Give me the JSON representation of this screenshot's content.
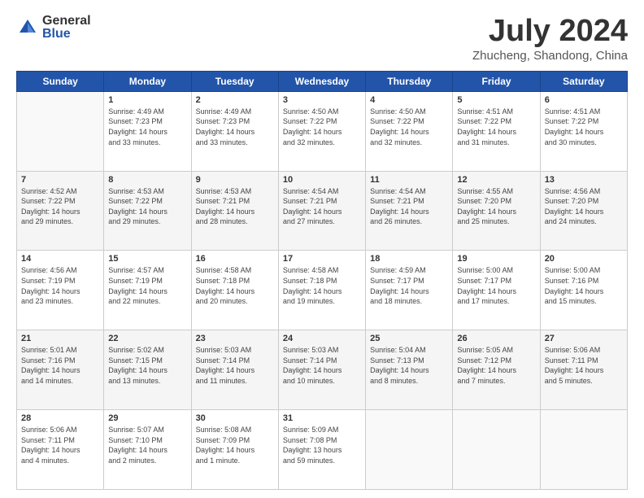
{
  "logo": {
    "general": "General",
    "blue": "Blue"
  },
  "title": "July 2024",
  "subtitle": "Zhucheng, Shandong, China",
  "days_of_week": [
    "Sunday",
    "Monday",
    "Tuesday",
    "Wednesday",
    "Thursday",
    "Friday",
    "Saturday"
  ],
  "weeks": [
    [
      {
        "day": "",
        "info": ""
      },
      {
        "day": "1",
        "info": "Sunrise: 4:49 AM\nSunset: 7:23 PM\nDaylight: 14 hours\nand 33 minutes."
      },
      {
        "day": "2",
        "info": "Sunrise: 4:49 AM\nSunset: 7:23 PM\nDaylight: 14 hours\nand 33 minutes."
      },
      {
        "day": "3",
        "info": "Sunrise: 4:50 AM\nSunset: 7:22 PM\nDaylight: 14 hours\nand 32 minutes."
      },
      {
        "day": "4",
        "info": "Sunrise: 4:50 AM\nSunset: 7:22 PM\nDaylight: 14 hours\nand 32 minutes."
      },
      {
        "day": "5",
        "info": "Sunrise: 4:51 AM\nSunset: 7:22 PM\nDaylight: 14 hours\nand 31 minutes."
      },
      {
        "day": "6",
        "info": "Sunrise: 4:51 AM\nSunset: 7:22 PM\nDaylight: 14 hours\nand 30 minutes."
      }
    ],
    [
      {
        "day": "7",
        "info": "Sunrise: 4:52 AM\nSunset: 7:22 PM\nDaylight: 14 hours\nand 29 minutes."
      },
      {
        "day": "8",
        "info": "Sunrise: 4:53 AM\nSunset: 7:22 PM\nDaylight: 14 hours\nand 29 minutes."
      },
      {
        "day": "9",
        "info": "Sunrise: 4:53 AM\nSunset: 7:21 PM\nDaylight: 14 hours\nand 28 minutes."
      },
      {
        "day": "10",
        "info": "Sunrise: 4:54 AM\nSunset: 7:21 PM\nDaylight: 14 hours\nand 27 minutes."
      },
      {
        "day": "11",
        "info": "Sunrise: 4:54 AM\nSunset: 7:21 PM\nDaylight: 14 hours\nand 26 minutes."
      },
      {
        "day": "12",
        "info": "Sunrise: 4:55 AM\nSunset: 7:20 PM\nDaylight: 14 hours\nand 25 minutes."
      },
      {
        "day": "13",
        "info": "Sunrise: 4:56 AM\nSunset: 7:20 PM\nDaylight: 14 hours\nand 24 minutes."
      }
    ],
    [
      {
        "day": "14",
        "info": "Sunrise: 4:56 AM\nSunset: 7:19 PM\nDaylight: 14 hours\nand 23 minutes."
      },
      {
        "day": "15",
        "info": "Sunrise: 4:57 AM\nSunset: 7:19 PM\nDaylight: 14 hours\nand 22 minutes."
      },
      {
        "day": "16",
        "info": "Sunrise: 4:58 AM\nSunset: 7:18 PM\nDaylight: 14 hours\nand 20 minutes."
      },
      {
        "day": "17",
        "info": "Sunrise: 4:58 AM\nSunset: 7:18 PM\nDaylight: 14 hours\nand 19 minutes."
      },
      {
        "day": "18",
        "info": "Sunrise: 4:59 AM\nSunset: 7:17 PM\nDaylight: 14 hours\nand 18 minutes."
      },
      {
        "day": "19",
        "info": "Sunrise: 5:00 AM\nSunset: 7:17 PM\nDaylight: 14 hours\nand 17 minutes."
      },
      {
        "day": "20",
        "info": "Sunrise: 5:00 AM\nSunset: 7:16 PM\nDaylight: 14 hours\nand 15 minutes."
      }
    ],
    [
      {
        "day": "21",
        "info": "Sunrise: 5:01 AM\nSunset: 7:16 PM\nDaylight: 14 hours\nand 14 minutes."
      },
      {
        "day": "22",
        "info": "Sunrise: 5:02 AM\nSunset: 7:15 PM\nDaylight: 14 hours\nand 13 minutes."
      },
      {
        "day": "23",
        "info": "Sunrise: 5:03 AM\nSunset: 7:14 PM\nDaylight: 14 hours\nand 11 minutes."
      },
      {
        "day": "24",
        "info": "Sunrise: 5:03 AM\nSunset: 7:14 PM\nDaylight: 14 hours\nand 10 minutes."
      },
      {
        "day": "25",
        "info": "Sunrise: 5:04 AM\nSunset: 7:13 PM\nDaylight: 14 hours\nand 8 minutes."
      },
      {
        "day": "26",
        "info": "Sunrise: 5:05 AM\nSunset: 7:12 PM\nDaylight: 14 hours\nand 7 minutes."
      },
      {
        "day": "27",
        "info": "Sunrise: 5:06 AM\nSunset: 7:11 PM\nDaylight: 14 hours\nand 5 minutes."
      }
    ],
    [
      {
        "day": "28",
        "info": "Sunrise: 5:06 AM\nSunset: 7:11 PM\nDaylight: 14 hours\nand 4 minutes."
      },
      {
        "day": "29",
        "info": "Sunrise: 5:07 AM\nSunset: 7:10 PM\nDaylight: 14 hours\nand 2 minutes."
      },
      {
        "day": "30",
        "info": "Sunrise: 5:08 AM\nSunset: 7:09 PM\nDaylight: 14 hours\nand 1 minute."
      },
      {
        "day": "31",
        "info": "Sunrise: 5:09 AM\nSunset: 7:08 PM\nDaylight: 13 hours\nand 59 minutes."
      },
      {
        "day": "",
        "info": ""
      },
      {
        "day": "",
        "info": ""
      },
      {
        "day": "",
        "info": ""
      }
    ]
  ]
}
